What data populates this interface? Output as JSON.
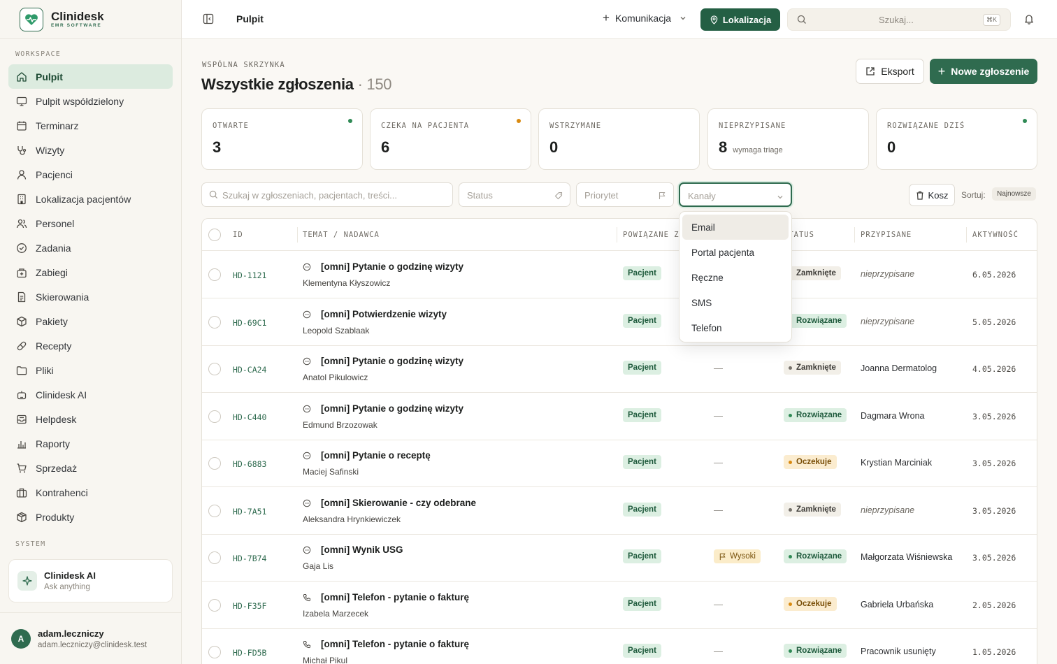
{
  "brand": {
    "name": "Clinidesk",
    "subtitle": "EMR SOFTWARE"
  },
  "sidebar": {
    "workspace_label": "WORKSPACE",
    "system_label": "SYSTEM",
    "items": [
      {
        "label": "Pulpit",
        "icon": "home-icon",
        "active": true
      },
      {
        "label": "Pulpit współdzielony",
        "icon": "monitor-icon"
      },
      {
        "label": "Terminarz",
        "icon": "calendar-icon"
      },
      {
        "label": "Wizyty",
        "icon": "stethoscope-icon"
      },
      {
        "label": "Pacjenci",
        "icon": "user-icon"
      },
      {
        "label": "Lokalizacja pacjentów",
        "icon": "building-icon"
      },
      {
        "label": "Personel",
        "icon": "users-icon"
      },
      {
        "label": "Zadania",
        "icon": "check-circle-icon"
      },
      {
        "label": "Zabiegi",
        "icon": "procedure-icon"
      },
      {
        "label": "Skierowania",
        "icon": "document-icon"
      },
      {
        "label": "Pakiety",
        "icon": "package-icon"
      },
      {
        "label": "Recepty",
        "icon": "pill-icon"
      },
      {
        "label": "Pliki",
        "icon": "folder-icon"
      },
      {
        "label": "Clinidesk AI",
        "icon": "robot-icon"
      },
      {
        "label": "Helpdesk",
        "icon": "inbox-icon"
      },
      {
        "label": "Raporty",
        "icon": "bar-chart-icon"
      },
      {
        "label": "Sprzedaż",
        "icon": "cart-icon"
      },
      {
        "label": "Kontrahenci",
        "icon": "briefcase-icon"
      },
      {
        "label": "Produkty",
        "icon": "box-icon"
      }
    ],
    "ai_card": {
      "title": "Clinidesk AI",
      "subtitle": "Ask anything"
    },
    "user": {
      "initial": "A",
      "name": "adam.leczniczy",
      "email": "adam.leczniczy@clinidesk.test"
    }
  },
  "topbar": {
    "breadcrumb": "Pulpit",
    "komunikacja": "Komunikacja",
    "lokalizacja": "Lokalizacja",
    "search_placeholder": "Szukaj...",
    "shortcut": "⌘K"
  },
  "page": {
    "eyebrow": "WSPÓLNA SKRZYNKA",
    "title": "Wszystkie zgłoszenia",
    "count": "· 150",
    "export_label": "Eksport",
    "new_label": "Nowe zgłoszenie"
  },
  "stats": [
    {
      "label": "OTWARTE",
      "value": "3",
      "dot": "#2f8a55"
    },
    {
      "label": "CZEKA NA PACJENTA",
      "value": "6",
      "dot": "#d98a10"
    },
    {
      "label": "WSTRZYMANE",
      "value": "0"
    },
    {
      "label": "NIEPRZYPISANE",
      "value": "8",
      "sub": "wymaga triage"
    },
    {
      "label": "ROZWIĄZANE DZIŚ",
      "value": "0",
      "dot": "#2f8a55"
    }
  ],
  "filters": {
    "search_placeholder": "Szukaj w zgłoszeniach, pacjentach, treści...",
    "status_placeholder": "Status",
    "priority_placeholder": "Priorytet",
    "channels_placeholder": "Kanały",
    "trash_label": "Kosz",
    "sort_label": "Sortuj:",
    "sort_value": "Najnowsze"
  },
  "table": {
    "headers": {
      "id": "ID",
      "subject": "TEMAT / NADAWCA",
      "related": "POWIĄZANE Z",
      "status": "STATUS",
      "assigned": "PRZYPISANE",
      "activity": "AKTYWNOŚĆ"
    },
    "rows": [
      {
        "id": "HD-1121",
        "icon": "chat-icon",
        "subject": "[omni] Pytanie o godzinę wizyty",
        "sender": "Klementyna Kłyszowicz",
        "related": "Pacjent",
        "priority": "",
        "status": "Zamknięte",
        "status_kind": "closed",
        "assignee": "nieprzypisane",
        "unassigned": true,
        "activity": "6.05.2026"
      },
      {
        "id": "HD-69C1",
        "icon": "chat-icon",
        "subject": "[omni] Potwierdzenie wizyty",
        "sender": "Leopold Szablaak",
        "related": "Pacjent",
        "priority": "",
        "status": "Rozwiązane",
        "status_kind": "resolved",
        "assignee": "nieprzypisane",
        "unassigned": true,
        "activity": "5.05.2026"
      },
      {
        "id": "HD-CA24",
        "icon": "chat-icon",
        "subject": "[omni] Pytanie o godzinę wizyty",
        "sender": "Anatol Pikulowicz",
        "related": "Pacjent",
        "priority": "—",
        "status": "Zamknięte",
        "status_kind": "closed",
        "assignee": "Joanna Dermatolog",
        "unassigned": false,
        "activity": "4.05.2026"
      },
      {
        "id": "HD-C440",
        "icon": "chat-icon",
        "subject": "[omni] Pytanie o godzinę wizyty",
        "sender": "Edmund Brzozowak",
        "related": "Pacjent",
        "priority": "—",
        "status": "Rozwiązane",
        "status_kind": "resolved",
        "assignee": "Dagmara Wrona",
        "unassigned": false,
        "activity": "3.05.2026"
      },
      {
        "id": "HD-6883",
        "icon": "chat-icon",
        "subject": "[omni] Pytanie o receptę",
        "sender": "Maciej Safinski",
        "related": "Pacjent",
        "priority": "—",
        "status": "Oczekuje",
        "status_kind": "wait",
        "assignee": "Krystian Marciniak",
        "unassigned": false,
        "activity": "3.05.2026"
      },
      {
        "id": "HD-7A51",
        "icon": "chat-icon",
        "subject": "[omni] Skierowanie - czy odebrane",
        "sender": "Aleksandra Hrynkiewiczek",
        "related": "Pacjent",
        "priority": "—",
        "status": "Zamknięte",
        "status_kind": "closed",
        "assignee": "nieprzypisane",
        "unassigned": true,
        "activity": "3.05.2026"
      },
      {
        "id": "HD-7B74",
        "icon": "chat-icon",
        "subject": "[omni] Wynik USG",
        "sender": "Gaja Lis",
        "related": "Pacjent",
        "priority": "Wysoki",
        "status": "Rozwiązane",
        "status_kind": "resolved",
        "assignee": "Małgorzata Wiśniewska",
        "unassigned": false,
        "activity": "3.05.2026"
      },
      {
        "id": "HD-F35F",
        "icon": "phone-icon",
        "subject": "[omni] Telefon - pytanie o fakturę",
        "sender": "Izabela Marzecek",
        "related": "Pacjent",
        "priority": "—",
        "status": "Oczekuje",
        "status_kind": "wait",
        "assignee": "Gabriela Urbańska",
        "unassigned": false,
        "activity": "2.05.2026"
      },
      {
        "id": "HD-FD5B",
        "icon": "phone-icon",
        "subject": "[omni] Telefon - pytanie o fakturę",
        "sender": "Michał Pikul",
        "related": "Pacjent",
        "priority": "—",
        "status": "Rozwiązane",
        "status_kind": "resolved",
        "assignee": "Pracownik usunięty",
        "unassigned": false,
        "activity": "1.05.2026"
      }
    ]
  },
  "dropdown": {
    "options": [
      "Email",
      "Portal pacjenta",
      "Ręczne",
      "SMS",
      "Telefon"
    ],
    "highlighted": "Email"
  },
  "colors": {
    "accent": "#2f6b4f",
    "accent_dark": "#245f44",
    "active_nav_bg": "#dcebdf"
  }
}
